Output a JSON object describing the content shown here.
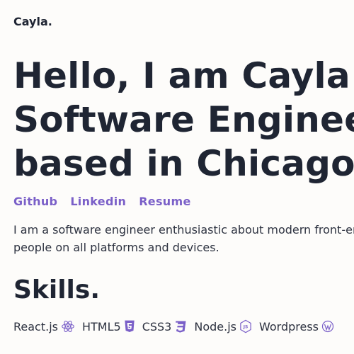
{
  "nav": {
    "brand": "Cayla."
  },
  "hero": {
    "line1": "Hello, I am Cayla",
    "line2": "Software Engineer",
    "line3": "based in Chicago"
  },
  "links": [
    {
      "label": "Github"
    },
    {
      "label": "Linkedin"
    },
    {
      "label": "Resume"
    }
  ],
  "intro": {
    "line1": "I am a software engineer enthusiastic about modern front-end",
    "line2": "people on all platforms and devices."
  },
  "skills": {
    "title": "Skills.",
    "items": [
      {
        "label": "React.js",
        "icon": "react-icon"
      },
      {
        "label": "HTML5",
        "icon": "html5-icon"
      },
      {
        "label": "CSS3",
        "icon": "css3-icon"
      },
      {
        "label": "Node.js",
        "icon": "nodejs-icon"
      },
      {
        "label": "Wordpress",
        "icon": "wordpress-icon"
      }
    ]
  },
  "colors": {
    "accent": "#7a5fc8",
    "text": "#1f2533",
    "background": "#fdfcfa"
  }
}
